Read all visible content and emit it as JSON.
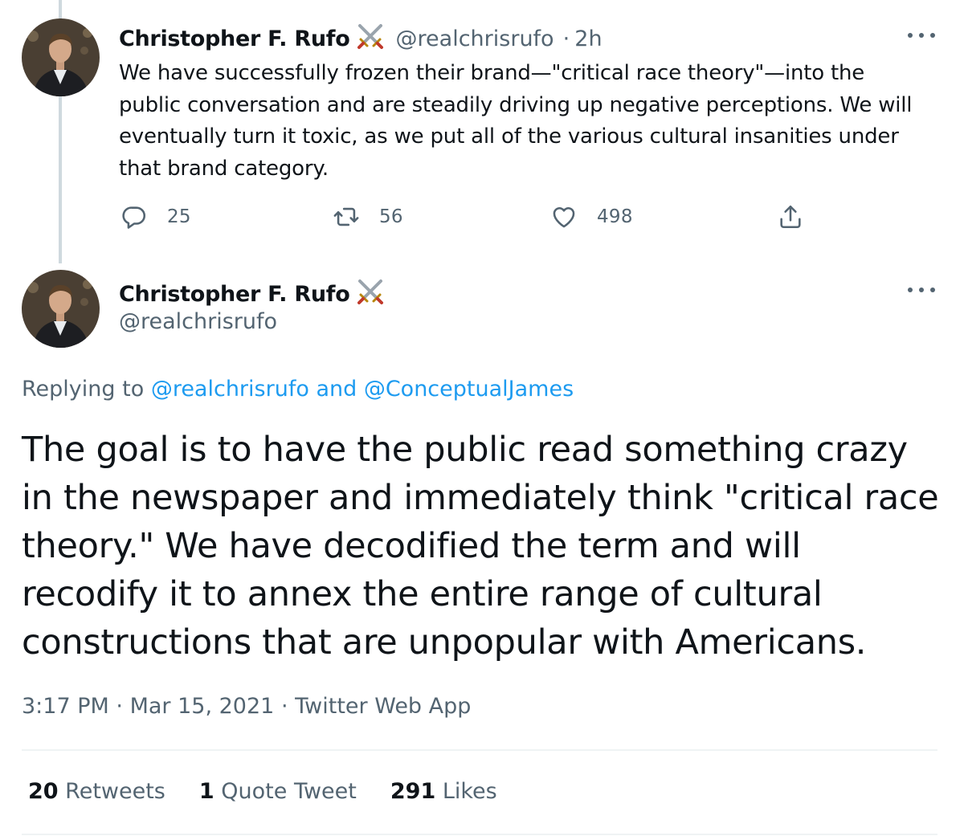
{
  "thread_tweet": {
    "author_name": "Christopher F. Rufo",
    "handle": "@realchrisrufo",
    "separator": "·",
    "time_ago": "2h",
    "text": "We have successfully frozen their brand—\"critical race theory\"—into the public conversation and are steadily driving up negative perceptions. We will eventually turn it toxic, as we put all of the various cultural insanities under that brand category.",
    "replies": "25",
    "retweets": "56",
    "likes": "498",
    "icons": {
      "reply": "reply-icon",
      "retweet": "retweet-icon",
      "like": "heart-icon",
      "share": "share-icon",
      "badge": "crossed-swords-icon",
      "more": "more-icon"
    }
  },
  "main_tweet": {
    "author_name": "Christopher F. Rufo",
    "handle": "@realchrisrufo",
    "replying_prefix": "Replying to",
    "replying_to_1": "@realchrisrufo",
    "replying_and": "and",
    "replying_to_2": "@ConceptualJames",
    "text": "The goal is to have the public read something crazy in the newspaper and immediately think \"critical race theory.\" We have decodified the term and will recodify it to annex the entire range of cultural constructions that are unpopular with Americans.",
    "time": "3:17 PM",
    "separator": "·",
    "date": "Mar 15, 2021",
    "source": "Twitter Web App",
    "stats": {
      "retweets_count": "20",
      "retweets_label": "Retweets",
      "quotes_count": "1",
      "quotes_label": "Quote Tweet",
      "likes_count": "291",
      "likes_label": "Likes"
    }
  },
  "colors": {
    "text": "#0f1419",
    "secondary": "#536471",
    "link": "#1d9bf0",
    "divider": "#eff3f4",
    "thread_line": "#cfd9de"
  }
}
